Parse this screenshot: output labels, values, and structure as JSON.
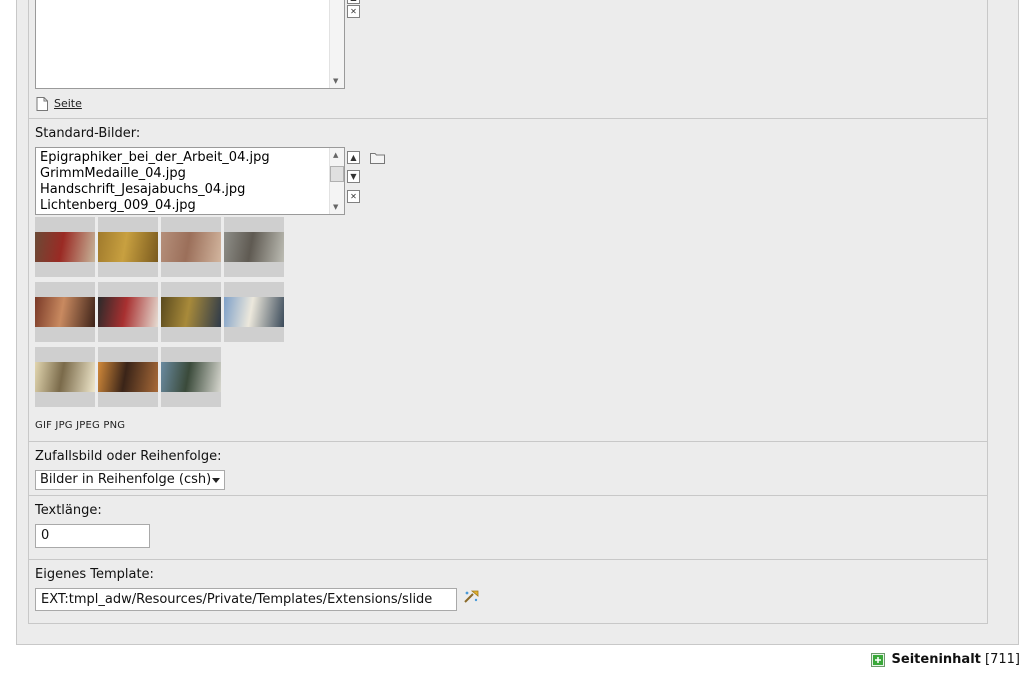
{
  "top_field": {
    "link_label": "Seite"
  },
  "standard_images": {
    "label": "Standard-Bilder:",
    "files": [
      "Epigraphiker_bei_der_Arbeit_04.jpg",
      "GrimmMedaille_04.jpg",
      "Handschrift_Jesajabuchs_04.jpg",
      "Lichtenberg_009_04.jpg"
    ],
    "thumbnails": [
      {
        "name": "Epigraphiker_bei_der_Arbeit_04.jpg",
        "colors": [
          "#6b4a36",
          "#9a2a24",
          "#c7b59a"
        ]
      },
      {
        "name": "GrimmMedaille_04.jpg",
        "colors": [
          "#a07a2c",
          "#c8a040",
          "#7a5a1e"
        ]
      },
      {
        "name": "Handschrift_Jesajabuchs_04.jpg",
        "colors": [
          "#b58f7a",
          "#9b6f5a",
          "#d2b59e"
        ]
      },
      {
        "name": "Lichtenberg_009_04.jpg",
        "colors": [
          "#8e8e88",
          "#5f5a52",
          "#bdbdb4"
        ]
      },
      {
        "name": "image5",
        "colors": [
          "#7a3a28",
          "#c98a60",
          "#3d2218"
        ]
      },
      {
        "name": "image6",
        "colors": [
          "#2a2a2a",
          "#a83030",
          "#e6dcd2"
        ]
      },
      {
        "name": "image7",
        "colors": [
          "#5a4a1e",
          "#a88a3a",
          "#2e3a4a"
        ]
      },
      {
        "name": "image8",
        "colors": [
          "#7ea0c8",
          "#ece8dc",
          "#3a4a5a"
        ]
      },
      {
        "name": "image9",
        "colors": [
          "#e2d6b0",
          "#7a6a4a",
          "#f0e8cc"
        ]
      },
      {
        "name": "image10",
        "colors": [
          "#d28a3a",
          "#3a2418",
          "#a86a38"
        ]
      },
      {
        "name": "image11",
        "colors": [
          "#6a8aa0",
          "#3a4a3a",
          "#d8d8d0"
        ]
      }
    ],
    "extensions": "GIF JPG JPEG PNG"
  },
  "random_order": {
    "label": "Zufallsbild oder Reihenfolge:",
    "selected": "Bilder in Reihenfolge (csh)"
  },
  "text_length": {
    "label": "Textlänge:",
    "value": "0"
  },
  "template": {
    "label": "Eigenes Template:",
    "value": "EXT:tmpl_adw/Resources/Private/Templates/Extensions/slide"
  },
  "footer": {
    "label": "Seiteninhalt",
    "id": "[711]"
  },
  "colors": {
    "panel_bg": "#ececec",
    "border": "#c8c8c8",
    "thumb_bg": "#cfcfcf",
    "footer_icon": "#3aa83a"
  }
}
